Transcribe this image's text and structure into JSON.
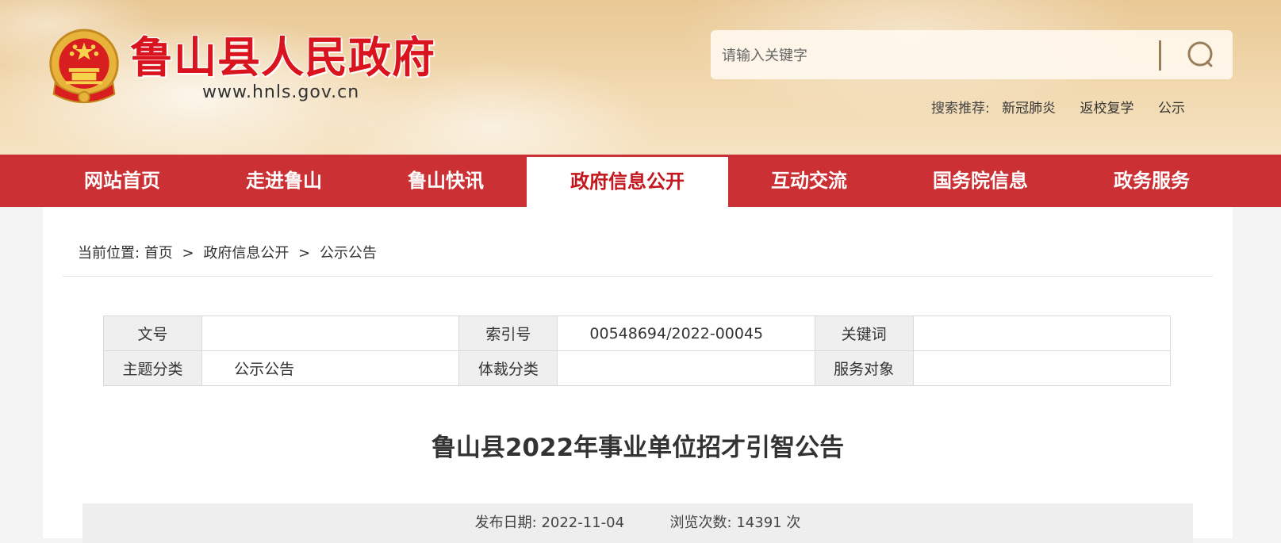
{
  "header": {
    "site_name": "鲁山县人民政府",
    "site_url": "www.hnls.gov.cn",
    "search": {
      "placeholder": "请输入关键字"
    },
    "hot_label": "搜索推荐:",
    "hot_terms": [
      "新冠肺炎",
      "返校复学",
      "公示"
    ]
  },
  "nav": {
    "items": [
      {
        "label": "网站首页"
      },
      {
        "label": "走进鲁山"
      },
      {
        "label": "鲁山快讯"
      },
      {
        "label": "政府信息公开",
        "active": true
      },
      {
        "label": "互动交流"
      },
      {
        "label": "国务院信息"
      },
      {
        "label": "政务服务"
      }
    ]
  },
  "breadcrumb": {
    "prefix": "当前位置:",
    "items": [
      "首页",
      "政府信息公开",
      "公示公告"
    ],
    "separator": ">"
  },
  "meta_table": {
    "rows": [
      [
        {
          "key": "文号",
          "value": ""
        },
        {
          "key": "索引号",
          "value": "00548694/2022-00045"
        },
        {
          "key": "关键词",
          "value": ""
        }
      ],
      [
        {
          "key": "主题分类",
          "value": "公示公告"
        },
        {
          "key": "体裁分类",
          "value": ""
        },
        {
          "key": "服务对象",
          "value": ""
        }
      ]
    ]
  },
  "article": {
    "title": "鲁山县2022年事业单位招才引智公告",
    "publish_label": "发布日期:",
    "publish_date": "2022-11-04",
    "views_label": "浏览次数:",
    "views": "14391",
    "views_unit": "次"
  },
  "colors": {
    "nav_red": "#cb3034",
    "brand_red": "#d9141e",
    "active_text": "#c4161c"
  }
}
